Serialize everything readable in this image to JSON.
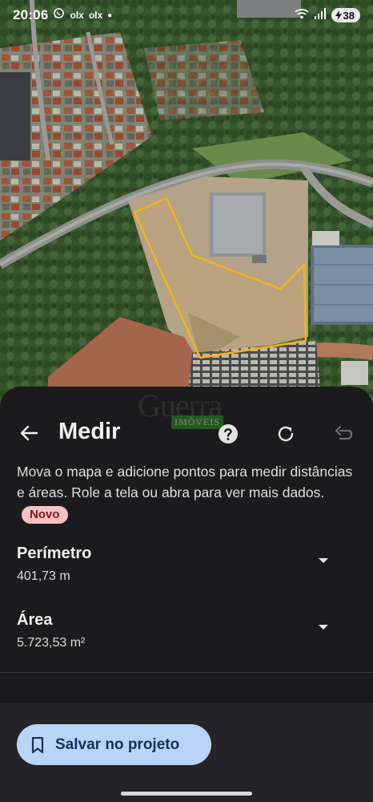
{
  "status_bar": {
    "time": "20:06",
    "notification_icons": [
      "whatsapp-icon",
      "olx-icon",
      "olx-icon"
    ],
    "olx_label_1": "olx",
    "olx_label_2": "olx",
    "battery_level": "38"
  },
  "watermark": {
    "brand": "Guerra",
    "sub": "IMÓVEIS"
  },
  "header": {
    "title": "Medir",
    "icons": [
      "back-arrow-icon",
      "help-icon",
      "refresh-icon",
      "undo-icon"
    ]
  },
  "instructions": {
    "text": "Mova o mapa e adicione pontos para medir distâncias e áreas. Role a tela ou abra para ver mais dados.",
    "badge": "Novo"
  },
  "measurements": {
    "perimeter": {
      "label": "Perímetro",
      "value": "401,73 m"
    },
    "area": {
      "label": "Área",
      "value": "5.723,53 m²"
    }
  },
  "actions": {
    "save_label": "Salvar no projeto",
    "save_icon": "bookmark-icon"
  },
  "colors": {
    "polygon_outline": "#f2b51d",
    "save_button_bg": "#b9d4f7",
    "sheet_bg": "#1b1b1d",
    "badge_bg": "#f6c2c2"
  }
}
